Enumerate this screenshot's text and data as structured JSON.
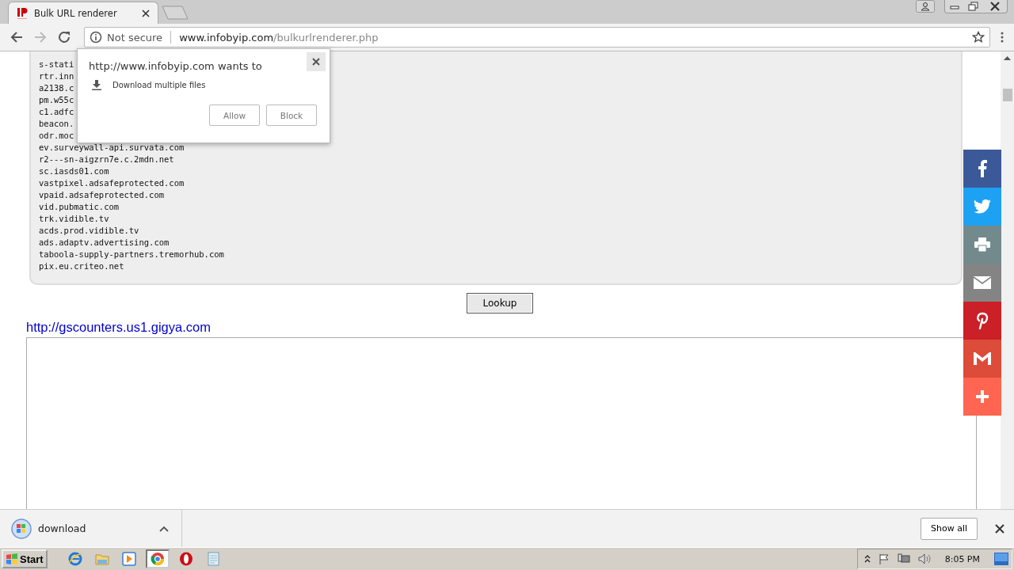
{
  "browser": {
    "tabs": [
      {
        "title": "Bulk URL renderer",
        "selected": true
      }
    ],
    "security": "Not secure",
    "url_host": "www.infobyip.com",
    "url_path": "/bulkurlrenderer.php"
  },
  "page": {
    "domains": [
      "s-stati",
      "rtr.inn",
      "a2138.c",
      "pm.w55c",
      "c1.adfc",
      "beacon.",
      "odr.moc",
      "ev.surveywall-api.survata.com",
      "r2---sn-aigzrn7e.c.2mdn.net",
      "sc.iasds01.com",
      "vastpixel.adsafeprotected.com",
      "vpaid.adsafeprotected.com",
      "vid.pubmatic.com",
      "trk.vidible.tv",
      "acds.prod.vidible.tv",
      "ads.adaptv.advertising.com",
      "taboola-supply-partners.tremorhub.com",
      "pix.eu.criteo.net"
    ],
    "lookup_button": "Lookup",
    "result_link": "http://gscounters.us1.gigya.com",
    "share_buttons": [
      {
        "kind": "facebook",
        "color": "#3b5998"
      },
      {
        "kind": "twitter",
        "color": "#1da1f2"
      },
      {
        "kind": "print",
        "color": "#738a8d"
      },
      {
        "kind": "email",
        "color": "#848484"
      },
      {
        "kind": "pinterest",
        "color": "#cb2027"
      },
      {
        "kind": "gmail",
        "color": "#dd4b39"
      },
      {
        "kind": "more",
        "color": "#ff6550"
      }
    ]
  },
  "permission_popup": {
    "message": "http://www.infobyip.com wants to",
    "request": "Download multiple files",
    "buttons": [
      "Allow",
      "Block"
    ]
  },
  "download_bar": {
    "items": [
      {
        "name": "download"
      }
    ],
    "show_all": "Show all"
  },
  "taskbar": {
    "start": "Start",
    "apps": [
      {
        "kind": "ie",
        "selected": false
      },
      {
        "kind": "folder",
        "selected": false
      },
      {
        "kind": "media",
        "selected": false
      },
      {
        "kind": "chrome",
        "selected": true
      },
      {
        "kind": "opera",
        "selected": false
      },
      {
        "kind": "notepad",
        "selected": false
      }
    ],
    "clock": "8:05 PM"
  }
}
